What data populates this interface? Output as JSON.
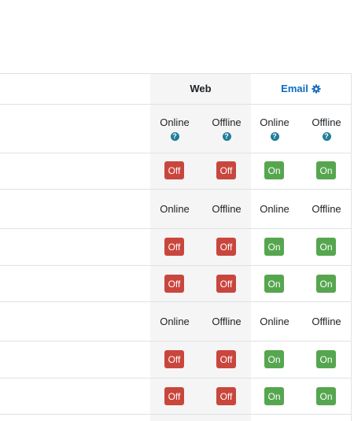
{
  "header": {
    "web_label": "Web",
    "email_label": "Email",
    "email_icon": "gear-icon"
  },
  "columns": {
    "online": "Online",
    "offline": "Offline"
  },
  "help_icon": "question-circle-icon",
  "toggles": {
    "off_label": "Off",
    "on_label": "On"
  },
  "colors": {
    "off": "#c9463d",
    "on": "#56a64f",
    "link": "#0f6cbf",
    "help": "#1f7e9a",
    "web_column_bg": "#f5f5f5"
  },
  "rows": [
    {
      "web_online": "Off",
      "web_offline": "Off",
      "email_online": "On",
      "email_offline": "On"
    },
    {
      "web_online": "Off",
      "web_offline": "Off",
      "email_online": "On",
      "email_offline": "On"
    },
    {
      "web_online": "Off",
      "web_offline": "Off",
      "email_online": "On",
      "email_offline": "On"
    },
    {
      "web_online": "Off",
      "web_offline": "Off",
      "email_online": "On",
      "email_offline": "On"
    },
    {
      "web_online": "Off",
      "web_offline": "Off",
      "email_online": "On",
      "email_offline": "On"
    }
  ]
}
